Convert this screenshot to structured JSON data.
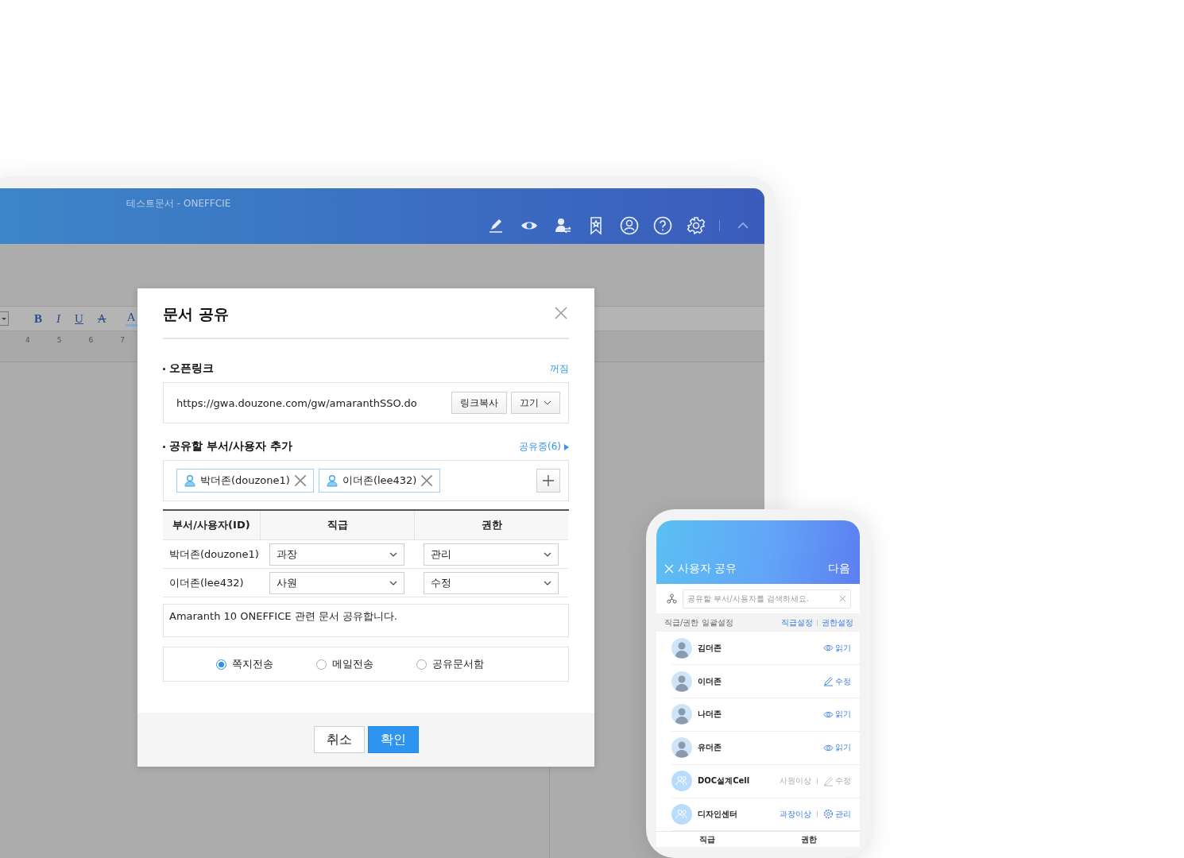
{
  "tablet": {
    "title": "테스트문서 - ONEFFCIE",
    "toolbar": [
      {
        "label": "B",
        "kind": "bold"
      },
      {
        "label": "I",
        "kind": "italic"
      },
      {
        "label": "U",
        "kind": "underline"
      },
      {
        "label": "A",
        "kind": "strike"
      },
      {
        "label": "A",
        "kind": "color"
      }
    ],
    "ruler": [
      "4",
      "5",
      "6",
      "7"
    ]
  },
  "dialog": {
    "title": "문서 공유",
    "open_link": {
      "label": "오픈링크",
      "status": "꺼짐",
      "url": "https://gwa.douzone.com/gw/amaranthSSO.do",
      "copy_button": "링크복사",
      "toggle": "끄기"
    },
    "add_section": {
      "label": "공유할 부서/사용자 추가",
      "sharing_link": "공유중(6)",
      "chips": [
        {
          "label": "박더존(douzone1)"
        },
        {
          "label": "이더존(lee432)"
        }
      ]
    },
    "table": {
      "columns": [
        "부서/사용자(ID)",
        "직급",
        "권한"
      ],
      "rows": [
        {
          "name": "박더존(douzone1)",
          "rank": "과장",
          "permission": "관리"
        },
        {
          "name": "이더존(lee432)",
          "rank": "사원",
          "permission": "수정"
        }
      ]
    },
    "message": "Amaranth 10 ONEFFICE 관련 문서 공유합니다.",
    "send_options": [
      {
        "label": "쪽지전송",
        "selected": true
      },
      {
        "label": "메일전송",
        "selected": false
      },
      {
        "label": "공유문서함",
        "selected": false
      }
    ],
    "buttons": [
      {
        "label": "취소",
        "kind": "secondary"
      },
      {
        "label": "확인",
        "kind": "primary"
      }
    ]
  },
  "phone": {
    "title": "사용자 공유",
    "next": "다음",
    "search": {
      "placeholder": "공유할 부서/사용자를 검색하세요."
    },
    "bulk_label": "직급/권한 일괄설정",
    "bulk_links": [
      "직급설정",
      "권한설정"
    ],
    "members": [
      {
        "name": "김더존",
        "kind": "person",
        "permission": {
          "label": "읽기",
          "kind": "read"
        },
        "disabled": false
      },
      {
        "name": "이더존",
        "kind": "person",
        "permission": {
          "label": "수정",
          "kind": "edit"
        },
        "disabled": false
      },
      {
        "name": "나더존",
        "kind": "person",
        "permission": {
          "label": "읽기",
          "kind": "read"
        },
        "disabled": false
      },
      {
        "name": "유더존",
        "kind": "person",
        "permission": {
          "label": "읽기",
          "kind": "read"
        },
        "disabled": false
      },
      {
        "name": "DOC설계Cell",
        "kind": "group",
        "rank": "사원이상",
        "permission": {
          "label": "수정",
          "kind": "edit"
        },
        "disabled": true
      },
      {
        "name": "디자인센터",
        "kind": "group",
        "rank": "과장이상",
        "permission": {
          "label": "관리",
          "kind": "manage"
        },
        "disabled": false
      }
    ],
    "footer_columns": [
      "직급",
      "권한"
    ]
  }
}
